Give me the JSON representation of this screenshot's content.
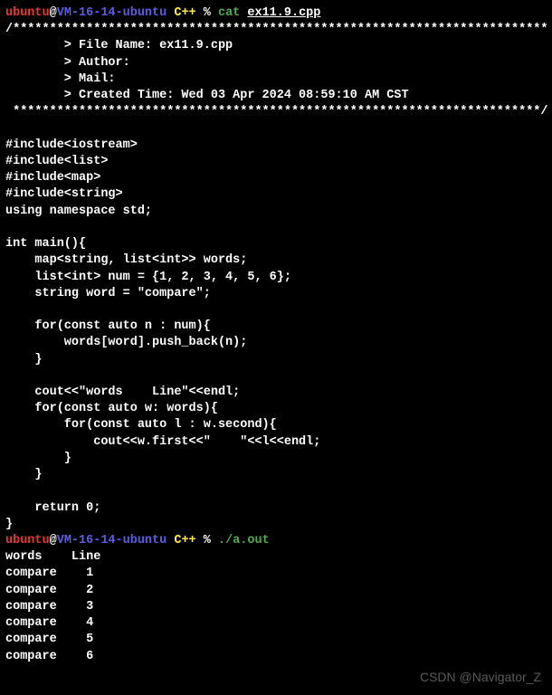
{
  "prompt1": {
    "user": "ubuntu",
    "at": "@",
    "host": "VM-16-14-ubuntu",
    "path": " C++",
    "percent": " % ",
    "cmd": "cat ",
    "arg": "ex11.9.cpp"
  },
  "code": "/*************************************************************************\n        > File Name: ex11.9.cpp\n        > Author:\n        > Mail:\n        > Created Time: Wed 03 Apr 2024 08:59:10 AM CST\n ************************************************************************/\n\n#include<iostream>\n#include<list>\n#include<map>\n#include<string>\nusing namespace std;\n\nint main(){\n    map<string, list<int>> words;\n    list<int> num = {1, 2, 3, 4, 5, 6};\n    string word = \"compare\";\n\n    for(const auto n : num){\n        words[word].push_back(n);\n    }\n\n    cout<<\"words    Line\"<<endl;\n    for(const auto w: words){\n        for(const auto l : w.second){\n            cout<<w.first<<\"    \"<<l<<endl;\n        }\n    }\n\n    return 0;\n}",
  "prompt2": {
    "user": "ubuntu",
    "at": "@",
    "host": "VM-16-14-ubuntu",
    "path": " C++",
    "percent": " % ",
    "cmd": "./a.out"
  },
  "output": "words    Line\ncompare    1\ncompare    2\ncompare    3\ncompare    4\ncompare    5\ncompare    6",
  "watermark": "CSDN @Navigator_Z"
}
